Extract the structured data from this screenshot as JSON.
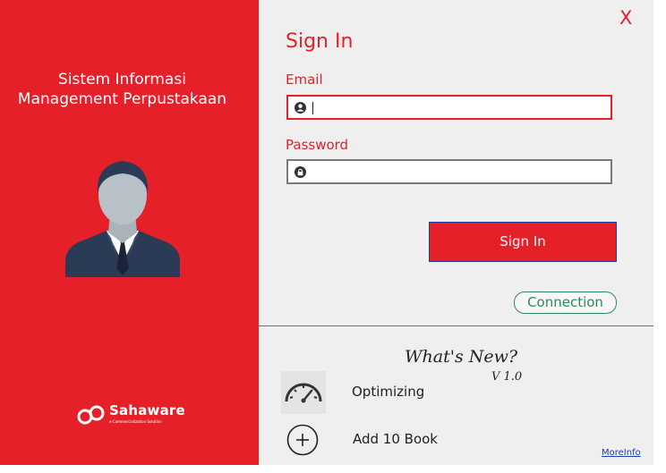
{
  "left_panel": {
    "title_line1": "Sistem Informasi",
    "title_line2": "Management Perpustakaan",
    "avatar_icon": "user-avatar-icon",
    "brand_name": "Sahaware",
    "brand_tagline": "e-Commercialization Solution"
  },
  "window": {
    "close_label": "X"
  },
  "signin": {
    "title": "Sign In",
    "email_label": "Email",
    "email_icon": "user-circle-icon",
    "email_value": "",
    "password_label": "Password",
    "password_icon": "lock-icon",
    "password_value": "",
    "submit_label": "Sign In",
    "connection_label": "Connection"
  },
  "whats_new": {
    "title": "What's New?",
    "version": "V 1.0",
    "items": [
      {
        "icon": "speedometer-icon",
        "label": "Optimizing"
      },
      {
        "icon": "plus-circle-icon",
        "label": "Add 10 Book"
      }
    ],
    "more_info": "MoreInfo"
  },
  "colors": {
    "accent": "#e52028",
    "panel_bg": "#efefef",
    "connection": "#2e8b57",
    "link": "#1a3fb0"
  }
}
